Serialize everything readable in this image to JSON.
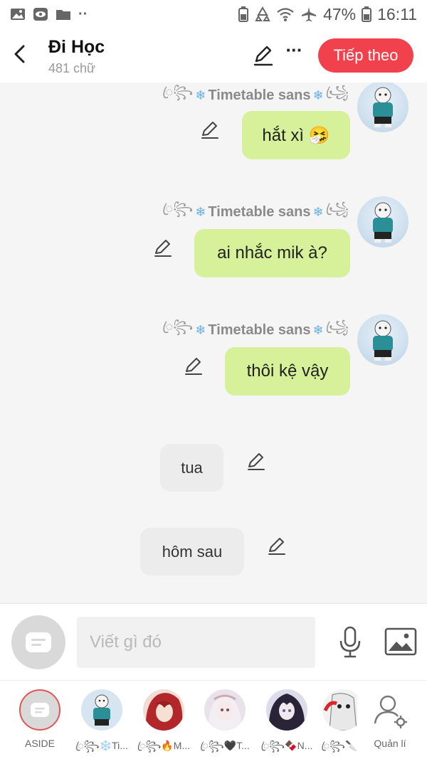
{
  "status_bar": {
    "battery": "47%",
    "time": "16:11"
  },
  "header": {
    "title": "Đi Học",
    "word_count": "481 chữ",
    "next_label": "Tiếp theo"
  },
  "messages": [
    {
      "sender": "Timetable sans",
      "text": "hắt xì 🤧",
      "side": "right"
    },
    {
      "sender": "Timetable sans",
      "text": "ai nhắc mik à?",
      "side": "right"
    },
    {
      "sender": "Timetable sans",
      "text": "thôi kệ vậy",
      "side": "right"
    },
    {
      "text": "tua",
      "side": "left"
    },
    {
      "text": "hôm sau",
      "side": "left"
    }
  ],
  "composer": {
    "placeholder": "Viết gì đó"
  },
  "characters": [
    {
      "label": "ASIDE"
    },
    {
      "label": "ꦿ꧂❄️Ti..."
    },
    {
      "label": "ꦿ꧂🔥M..."
    },
    {
      "label": "ꦿ꧂🖤T..."
    },
    {
      "label": "ꦿ꧂🍫N..."
    },
    {
      "label": "ꦿ꧂🔪"
    },
    {
      "label": "Quản lí"
    }
  ],
  "colors": {
    "accent": "#f0414d",
    "bubble_right": "#d7f19a",
    "bubble_left": "#ececec",
    "background": "#f5f5f5"
  }
}
